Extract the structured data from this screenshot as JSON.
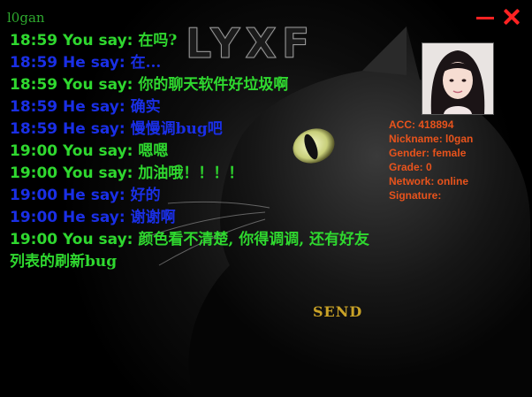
{
  "window": {
    "title": "l0gan"
  },
  "logo": {
    "text": "LYXF"
  },
  "messages": [
    {
      "time": "18:59",
      "speaker": "You say:",
      "text": "在吗?",
      "kind": "you"
    },
    {
      "time": "18:59",
      "speaker": "He say:",
      "text": "在...",
      "kind": "he"
    },
    {
      "time": "18:59",
      "speaker": "You say:",
      "text": "你的聊天软件好垃圾啊",
      "kind": "you"
    },
    {
      "time": "18:59",
      "speaker": "He say:",
      "text": "确实",
      "kind": "he"
    },
    {
      "time": "18:59",
      "speaker": "He say:",
      "text": "慢慢调bug吧",
      "kind": "he"
    },
    {
      "time": "19:00",
      "speaker": "You say:",
      "text": "嗯嗯",
      "kind": "you"
    },
    {
      "time": "19:00",
      "speaker": "You say:",
      "text": "加油哦！！！！",
      "kind": "you"
    },
    {
      "time": "19:00",
      "speaker": "He say:",
      "text": "好的",
      "kind": "he"
    },
    {
      "time": "19:00",
      "speaker": "He say:",
      "text": "谢谢啊",
      "kind": "he"
    },
    {
      "time": "19:00",
      "speaker": "You say:",
      "text": "颜色看不清楚, 你得调调, 还有好友列表的刷新bug",
      "kind": "you"
    }
  ],
  "profile": {
    "acc": "ACC: 418894",
    "nickname": "Nickname: l0gan",
    "gender": "Gender: female",
    "grade": "Grade: 0",
    "network": "Network: online",
    "signature": "Signature:"
  },
  "send": {
    "label": "SEND"
  },
  "icons": {
    "minimize": "minimize-icon",
    "close": "close-icon"
  },
  "colors": {
    "you": "#2fd82f",
    "he": "#1a2fe6",
    "profile": "#e8531c",
    "send": "#c9a227",
    "controls": "#ff2222"
  }
}
